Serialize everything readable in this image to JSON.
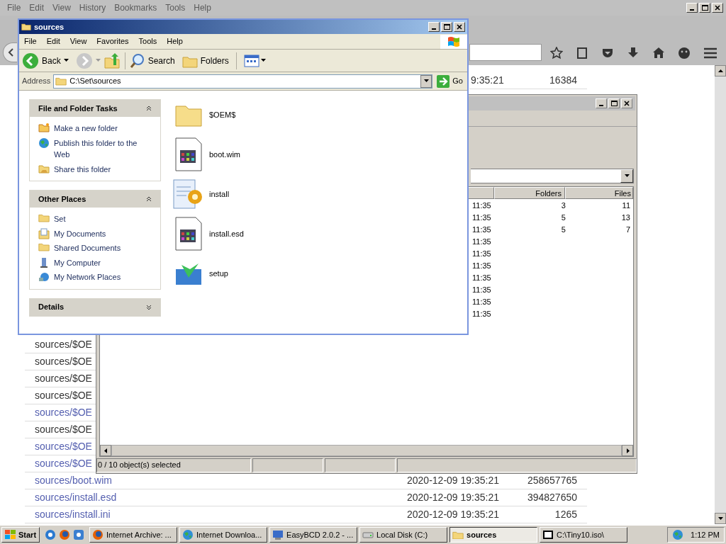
{
  "browser": {
    "menu": [
      "File",
      "Edit",
      "View",
      "History",
      "Bookmarks",
      "Tools",
      "Help"
    ],
    "top_row": {
      "time": "9:35:21",
      "size": "16384"
    },
    "partial_rows": [
      {
        "name": "sources/$OE",
        "linked": false
      },
      {
        "name": "sources/$OE",
        "linked": false
      },
      {
        "name": "sources/$OE",
        "linked": false
      },
      {
        "name": "sources/$OE",
        "linked": false
      },
      {
        "name": "sources/$OE",
        "linked": true
      },
      {
        "name": "sources/$OE",
        "linked": false
      },
      {
        "name": "sources/$OE",
        "linked": true
      },
      {
        "name": "sources/$OE",
        "linked": true
      }
    ],
    "rows": [
      {
        "name": "sources/boot.wim",
        "date": "2020-12-09 19:35:21",
        "size": "258657765"
      },
      {
        "name": "sources/install.esd",
        "date": "2020-12-09 19:35:21",
        "size": "394827650"
      },
      {
        "name": "sources/install.ini",
        "date": "2020-12-09 19:35:21",
        "size": "1265"
      }
    ]
  },
  "archiver": {
    "columns": [
      "Folders",
      "Files"
    ],
    "rows": [
      {
        "time": "11:35",
        "folders": "3",
        "files": "11"
      },
      {
        "time": "11:35",
        "folders": "5",
        "files": "13"
      },
      {
        "time": "11:35",
        "folders": "5",
        "files": "7"
      },
      {
        "time": "11:35"
      },
      {
        "time": "11:35"
      },
      {
        "time": "11:35"
      },
      {
        "time": "11:35"
      },
      {
        "time": "11:35"
      },
      {
        "time": "11:35"
      },
      {
        "time": "11:35"
      }
    ],
    "status": "0 / 10 object(s) selected"
  },
  "explorer": {
    "title": "sources",
    "menu": [
      "File",
      "Edit",
      "View",
      "Favorites",
      "Tools",
      "Help"
    ],
    "toolbar": {
      "back": "Back",
      "search": "Search",
      "folders": "Folders"
    },
    "address": {
      "label": "Address",
      "value": "C:\\Set\\sources",
      "go": "Go"
    },
    "panels": [
      {
        "title": "File and Folder Tasks",
        "expanded": true,
        "items": [
          {
            "label": "Make a new folder",
            "kind": "newfolder"
          },
          {
            "label": "Publish this folder to the Web",
            "kind": "globe"
          },
          {
            "label": "Share this folder",
            "kind": "share"
          }
        ]
      },
      {
        "title": "Other Places",
        "expanded": true,
        "items": [
          {
            "label": "Set",
            "kind": "folder"
          },
          {
            "label": "My Documents",
            "kind": "documents"
          },
          {
            "label": "Shared Documents",
            "kind": "folder"
          },
          {
            "label": "My Computer",
            "kind": "computer"
          },
          {
            "label": "My Network Places",
            "kind": "network"
          }
        ]
      },
      {
        "title": "Details",
        "expanded": false
      }
    ],
    "files": [
      {
        "name": "$OEM$",
        "kind": "folder"
      },
      {
        "name": "boot.wim",
        "kind": "image"
      },
      {
        "name": "install",
        "kind": "settings"
      },
      {
        "name": "install.esd",
        "kind": "image"
      },
      {
        "name": "setup",
        "kind": "installer"
      }
    ]
  },
  "taskbar": {
    "start": "Start",
    "tasks": [
      {
        "label": "Internet Archive: ...",
        "selected": false,
        "kind": "firefox"
      },
      {
        "label": "Internet Downloa...",
        "selected": false,
        "kind": "globe"
      },
      {
        "label": "EasyBCD 2.0.2 - ...",
        "selected": false,
        "kind": "app"
      },
      {
        "label": "Local Disk (C:)",
        "selected": false,
        "kind": "disk"
      },
      {
        "label": "sources",
        "selected": true,
        "kind": "folder"
      },
      {
        "label": "C:\\Tiny10.iso\\",
        "selected": false,
        "kind": "zip"
      }
    ],
    "clock": "1:12 PM"
  }
}
